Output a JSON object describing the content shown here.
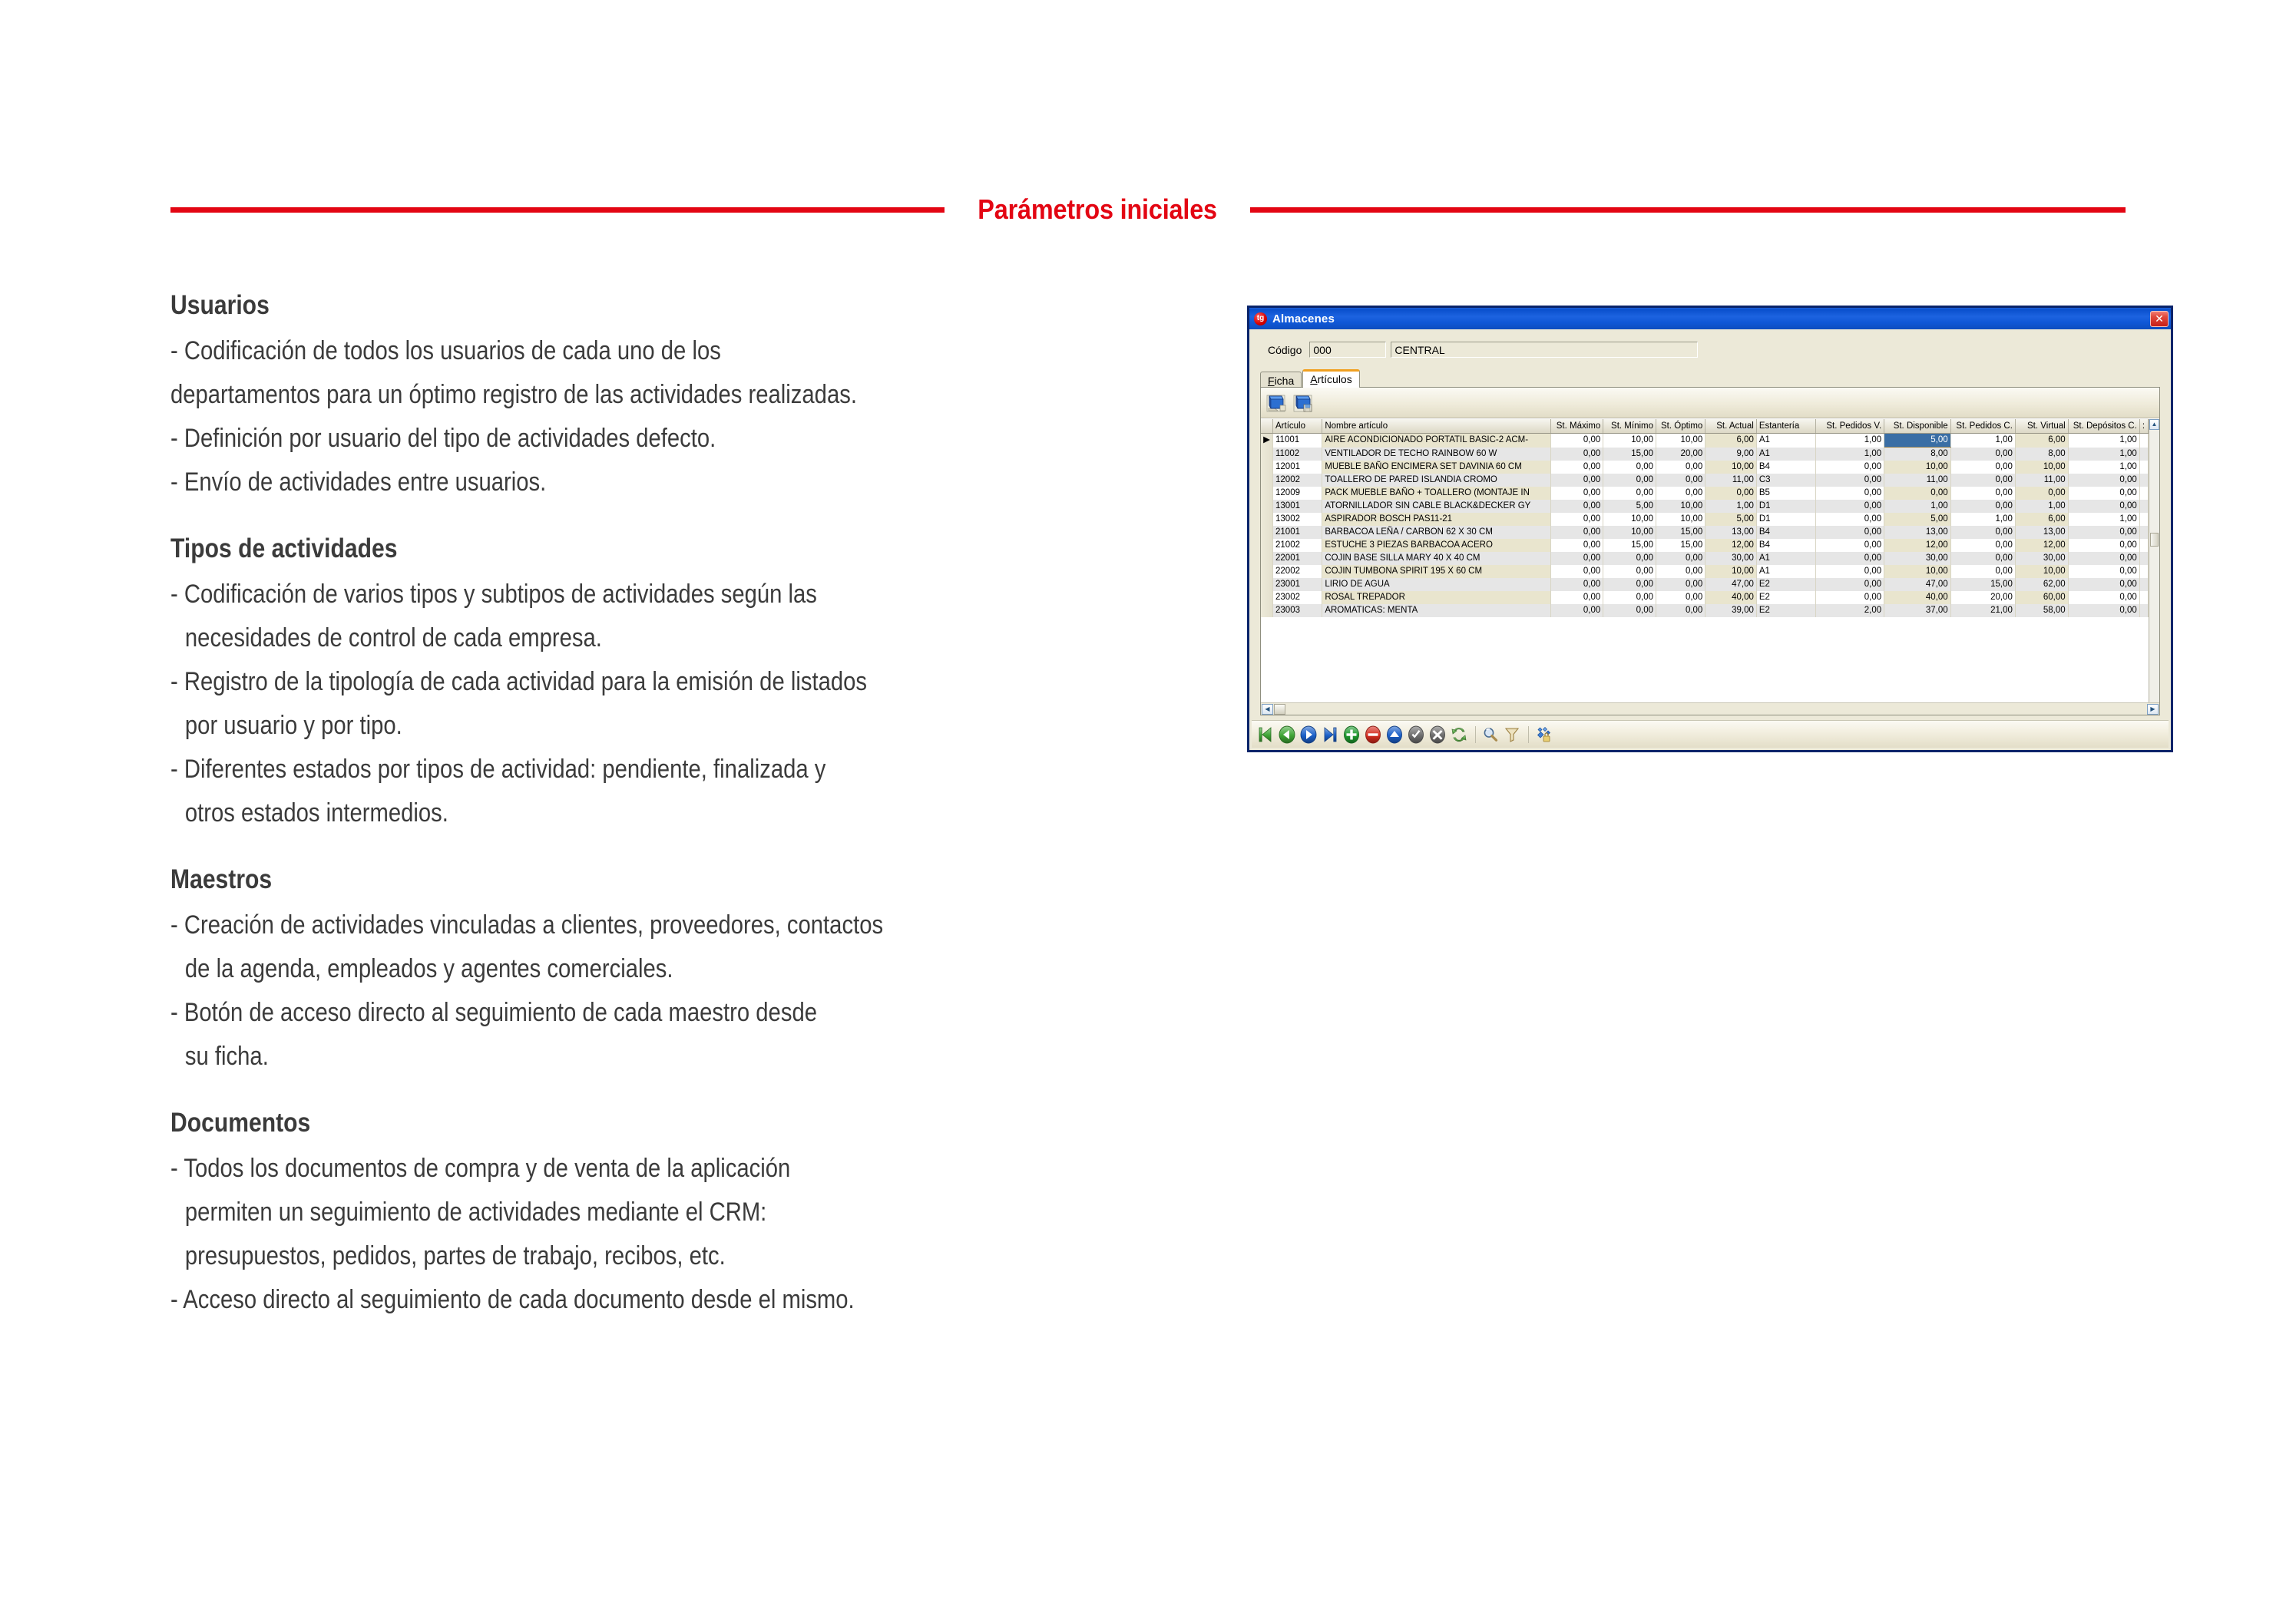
{
  "header": {
    "title": "Parámetros iniciales",
    "accent_color": "#E30613"
  },
  "content": {
    "sections": [
      {
        "title": "Usuarios",
        "lines": [
          {
            "text": "- Codificación de todos los usuarios de cada uno de los",
            "indent": false
          },
          {
            "text": "departamentos para un óptimo registro de las actividades realizadas.",
            "indent": false
          },
          {
            "text": "- Definición por usuario del tipo de actividades defecto.",
            "indent": false
          },
          {
            "text": "- Envío de actividades entre usuarios.",
            "indent": false
          }
        ]
      },
      {
        "title": "Tipos de actividades",
        "lines": [
          {
            "text": "- Codificación de varios tipos y subtipos de actividades según las",
            "indent": false
          },
          {
            "text": "necesidades de control de cada empresa.",
            "indent": true
          },
          {
            "text": "- Registro de la tipología de cada actividad para la emisión de listados",
            "indent": false
          },
          {
            "text": "por usuario y por tipo.",
            "indent": true
          },
          {
            "text": "- Diferentes estados por tipos de actividad: pendiente, finalizada y",
            "indent": false
          },
          {
            "text": "otros estados intermedios.",
            "indent": true
          }
        ]
      },
      {
        "title": "Maestros",
        "lines": [
          {
            "text": "- Creación de actividades vinculadas a clientes, proveedores, contactos",
            "indent": false
          },
          {
            "text": "de la agenda, empleados y agentes comerciales.",
            "indent": true
          },
          {
            "text": "- Botón de acceso directo al seguimiento de cada maestro desde",
            "indent": false
          },
          {
            "text": "su ficha.",
            "indent": true
          }
        ]
      },
      {
        "title": "Documentos",
        "lines": [
          {
            "text": "- Todos los documentos de compra y de venta de la aplicación",
            "indent": false
          },
          {
            "text": "permiten un seguimiento de actividades mediante el CRM:",
            "indent": true
          },
          {
            "text": "presupuestos, pedidos, partes de trabajo, recibos, etc.",
            "indent": true
          },
          {
            "text": "- Acceso directo al seguimiento de cada documento desde el mismo.",
            "indent": false
          }
        ]
      }
    ]
  },
  "app_window": {
    "title": "Almacenes",
    "app_icon_text": "tg",
    "close_label": "✕",
    "titlebar_color": "#0E52CC",
    "form": {
      "codigo_label": "Código",
      "codigo_value": "000",
      "nombre_value": "CENTRAL"
    },
    "tabs": [
      {
        "label": "Ficha",
        "active": false
      },
      {
        "label": "Artículos",
        "active": true
      }
    ],
    "panel_toolbar": [
      {
        "name": "book-edit-icon"
      },
      {
        "name": "book-save-icon"
      }
    ],
    "grid": {
      "columns": [
        {
          "key": "mark",
          "label": "",
          "align": "left",
          "cls": "c-mark"
        },
        {
          "key": "art",
          "label": "Artículo",
          "align": "left",
          "cls": "c-art"
        },
        {
          "key": "nom",
          "label": "Nombre artículo",
          "align": "left",
          "cls": "c-nom"
        },
        {
          "key": "max",
          "label": "St. Máximo",
          "align": "right",
          "cls": "c-max"
        },
        {
          "key": "min",
          "label": "St. Mínimo",
          "align": "right",
          "cls": "c-min"
        },
        {
          "key": "opt",
          "label": "St. Óptimo",
          "align": "right",
          "cls": "c-opt"
        },
        {
          "key": "act",
          "label": "St. Actual",
          "align": "right",
          "cls": "c-act"
        },
        {
          "key": "est",
          "label": "Estantería",
          "align": "left",
          "cls": "c-est"
        },
        {
          "key": "pedv",
          "label": "St. Pedidos V.",
          "align": "right",
          "cls": "c-pedv"
        },
        {
          "key": "disp",
          "label": "St. Disponible",
          "align": "right",
          "cls": "c-disp"
        },
        {
          "key": "pedc",
          "label": "St. Pedidos C.",
          "align": "right",
          "cls": "c-pedc"
        },
        {
          "key": "virt",
          "label": "St. Virtual",
          "align": "right",
          "cls": "c-virt"
        },
        {
          "key": "depc",
          "label": "St. Depósitos C.",
          "align": "right",
          "cls": "c-depc"
        },
        {
          "key": "tail",
          "label": ":",
          "align": "left",
          "cls": "c-tail"
        }
      ],
      "selected_cell": {
        "row": 0,
        "column": "disp"
      },
      "rows": [
        {
          "mark": "▶",
          "art": "11001",
          "nom": "AIRE ACONDICIONADO PORTATIL BASIC-2 ACM-",
          "max": "0,00",
          "min": "10,00",
          "opt": "10,00",
          "act": "6,00",
          "est": "A1",
          "pedv": "1,00",
          "disp": "5,00",
          "pedc": "1,00",
          "virt": "6,00",
          "depc": "1,00"
        },
        {
          "mark": "",
          "art": "11002",
          "nom": "VENTILADOR DE TECHO RAINBOW 60 W",
          "max": "0,00",
          "min": "15,00",
          "opt": "20,00",
          "act": "9,00",
          "est": "A1",
          "pedv": "1,00",
          "disp": "8,00",
          "pedc": "0,00",
          "virt": "8,00",
          "depc": "1,00"
        },
        {
          "mark": "",
          "art": "12001",
          "nom": "MUEBLE BAÑO ENCIMERA SET DAVINIA 60 CM",
          "max": "0,00",
          "min": "0,00",
          "opt": "0,00",
          "act": "10,00",
          "est": "B4",
          "pedv": "0,00",
          "disp": "10,00",
          "pedc": "0,00",
          "virt": "10,00",
          "depc": "1,00"
        },
        {
          "mark": "",
          "art": "12002",
          "nom": "TOALLERO DE PARED ISLANDIA CROMO",
          "max": "0,00",
          "min": "0,00",
          "opt": "0,00",
          "act": "11,00",
          "est": "C3",
          "pedv": "0,00",
          "disp": "11,00",
          "pedc": "0,00",
          "virt": "11,00",
          "depc": "0,00"
        },
        {
          "mark": "",
          "art": "12009",
          "nom": "PACK MUEBLE BAÑO + TOALLERO (MONTAJE IN",
          "max": "0,00",
          "min": "0,00",
          "opt": "0,00",
          "act": "0,00",
          "est": "B5",
          "pedv": "0,00",
          "disp": "0,00",
          "pedc": "0,00",
          "virt": "0,00",
          "depc": "0,00"
        },
        {
          "mark": "",
          "art": "13001",
          "nom": "ATORNILLADOR SIN CABLE BLACK&DECKER GY",
          "max": "0,00",
          "min": "5,00",
          "opt": "10,00",
          "act": "1,00",
          "est": "D1",
          "pedv": "0,00",
          "disp": "1,00",
          "pedc": "0,00",
          "virt": "1,00",
          "depc": "0,00"
        },
        {
          "mark": "",
          "art": "13002",
          "nom": "ASPIRADOR BOSCH PAS11-21",
          "max": "0,00",
          "min": "10,00",
          "opt": "10,00",
          "act": "5,00",
          "est": "D1",
          "pedv": "0,00",
          "disp": "5,00",
          "pedc": "1,00",
          "virt": "6,00",
          "depc": "1,00"
        },
        {
          "mark": "",
          "art": "21001",
          "nom": "BARBACOA LEÑA / CARBON 62 X 30 CM",
          "max": "0,00",
          "min": "10,00",
          "opt": "15,00",
          "act": "13,00",
          "est": "B4",
          "pedv": "0,00",
          "disp": "13,00",
          "pedc": "0,00",
          "virt": "13,00",
          "depc": "0,00"
        },
        {
          "mark": "",
          "art": "21002",
          "nom": "ESTUCHE 3 PIEZAS BARBACOA ACERO",
          "max": "0,00",
          "min": "15,00",
          "opt": "15,00",
          "act": "12,00",
          "est": "B4",
          "pedv": "0,00",
          "disp": "12,00",
          "pedc": "0,00",
          "virt": "12,00",
          "depc": "0,00"
        },
        {
          "mark": "",
          "art": "22001",
          "nom": "COJIN BASE SILLA MARY 40 X 40 CM",
          "max": "0,00",
          "min": "0,00",
          "opt": "0,00",
          "act": "30,00",
          "est": "A1",
          "pedv": "0,00",
          "disp": "30,00",
          "pedc": "0,00",
          "virt": "30,00",
          "depc": "0,00"
        },
        {
          "mark": "",
          "art": "22002",
          "nom": "COJIN TUMBONA SPIRIT 195 X 60 CM",
          "max": "0,00",
          "min": "0,00",
          "opt": "0,00",
          "act": "10,00",
          "est": "A1",
          "pedv": "0,00",
          "disp": "10,00",
          "pedc": "0,00",
          "virt": "10,00",
          "depc": "0,00"
        },
        {
          "mark": "",
          "art": "23001",
          "nom": "LIRIO DE AGUA",
          "max": "0,00",
          "min": "0,00",
          "opt": "0,00",
          "act": "47,00",
          "est": "E2",
          "pedv": "0,00",
          "disp": "47,00",
          "pedc": "15,00",
          "virt": "62,00",
          "depc": "0,00"
        },
        {
          "mark": "",
          "art": "23002",
          "nom": "ROSAL TREPADOR",
          "max": "0,00",
          "min": "0,00",
          "opt": "0,00",
          "act": "40,00",
          "est": "E2",
          "pedv": "0,00",
          "disp": "40,00",
          "pedc": "20,00",
          "virt": "60,00",
          "depc": "0,00"
        },
        {
          "mark": "",
          "art": "23003",
          "nom": "AROMATICAS: MENTA",
          "max": "0,00",
          "min": "0,00",
          "opt": "0,00",
          "act": "39,00",
          "est": "E2",
          "pedv": "2,00",
          "disp": "37,00",
          "pedc": "21,00",
          "virt": "58,00",
          "depc": "0,00"
        }
      ]
    },
    "navbar": [
      {
        "name": "first-record-icon",
        "glyph": "first",
        "color": "#3FA535"
      },
      {
        "name": "previous-record-icon",
        "glyph": "prev",
        "color": "#3FA535"
      },
      {
        "name": "next-record-icon",
        "glyph": "next",
        "color": "#1B60C9"
      },
      {
        "name": "last-record-icon",
        "glyph": "last",
        "color": "#1B60C9"
      },
      {
        "name": "add-record-icon",
        "glyph": "plus",
        "color": "#1F9A2E"
      },
      {
        "name": "delete-record-icon",
        "glyph": "minus",
        "color": "#D52B1E"
      },
      {
        "name": "edit-record-icon",
        "glyph": "up",
        "color": "#1B60C9"
      },
      {
        "name": "confirm-record-icon",
        "glyph": "check",
        "color": "#6E6E6E"
      },
      {
        "name": "cancel-record-icon",
        "glyph": "x",
        "color": "#6E6E6E"
      },
      {
        "name": "refresh-icon",
        "glyph": "refresh",
        "color": "#5FB14B"
      },
      {
        "name": "separator",
        "glyph": "sep",
        "color": ""
      },
      {
        "name": "search-icon",
        "glyph": "search",
        "color": "#8BA6C4"
      },
      {
        "name": "filter-icon",
        "glyph": "filter",
        "color": "#C9A96B"
      },
      {
        "name": "separator",
        "glyph": "sep",
        "color": ""
      },
      {
        "name": "tools-icon",
        "glyph": "tools",
        "color": "#2F6FCB"
      }
    ]
  }
}
